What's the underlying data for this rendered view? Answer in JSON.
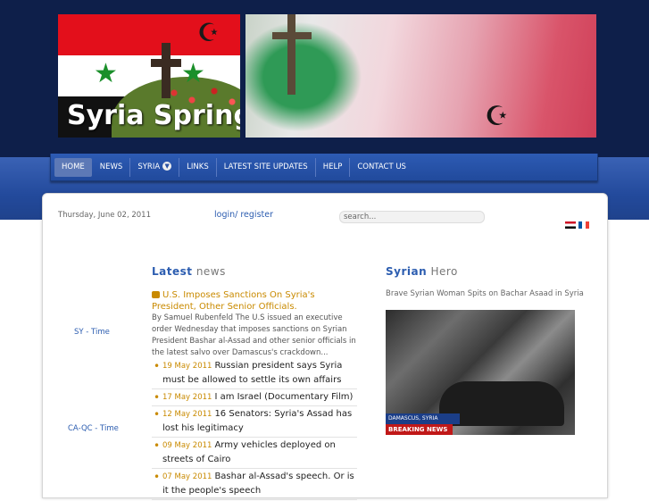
{
  "site": {
    "logo_text": "Syria Spring"
  },
  "nav": {
    "items": [
      {
        "label": "HOME",
        "active": true
      },
      {
        "label": "NEWS"
      },
      {
        "label": "SYRIA",
        "has_dropdown": true
      },
      {
        "label": "LINKS"
      },
      {
        "label": "LATEST SITE UPDATES"
      },
      {
        "label": "HELP"
      },
      {
        "label": "CONTACT US"
      }
    ]
  },
  "topbar": {
    "date": "Thursday, June 02, 2011",
    "login": "login/ register",
    "search_value": "search..."
  },
  "sidebar": {
    "links": [
      "SY - Time",
      "CA-QC - Time"
    ]
  },
  "latest": {
    "title_hl": "Latest",
    "title_rest": " news",
    "featured_title": "U.S. Imposes Sanctions On Syria's President, Other Senior Officials.",
    "featured_excerpt": "By Samuel Rubenfeld The U.S issued an executive order Wednesday that imposes sanctions on Syrian President Bashar al-Assad and other senior officials in the latest salvo over Damascus's crackdown...",
    "items": [
      {
        "date": "19 May 2011",
        "title": "Russian president says Syria must be allowed to settle its own affairs"
      },
      {
        "date": "17 May 2011",
        "title": "I am Israel (Documentary Film)"
      },
      {
        "date": "12 May 2011",
        "title": "16 Senators: Syria's Assad has lost his legitimacy"
      },
      {
        "date": "09 May 2011",
        "title": "Army vehicles deployed on streets of Cairo"
      },
      {
        "date": "07 May 2011",
        "title": "Bashar al-Assad's speech. Or is it the people's speech"
      }
    ]
  },
  "hero": {
    "title_hl": "Syrian",
    "title_rest": " Hero",
    "caption": "Brave Syrian Woman Spits on Bachar Asaad in Syria",
    "video_lower": "DAMASCUS, SYRIA",
    "video_breaking": "BREAKING NEWS"
  },
  "colors": {
    "header": "#0e1f4a",
    "nav": "#2b55a8",
    "accent_link": "#2c5db0",
    "date_accent": "#c98a00"
  }
}
